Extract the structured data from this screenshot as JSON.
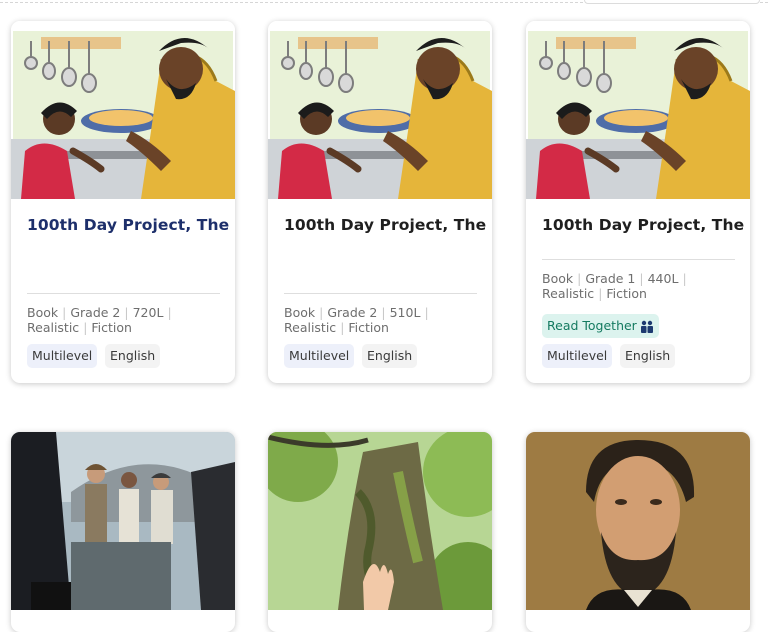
{
  "cards": [
    {
      "title": "100th Day Project, The",
      "meta": {
        "type": "Book",
        "grade": "Grade 2",
        "level": "720L",
        "genre": "Realistic",
        "category": "Fiction"
      },
      "tags": [
        "Multilevel",
        "English"
      ]
    },
    {
      "title": "100th Day Project, The",
      "meta": {
        "type": "Book",
        "grade": "Grade 2",
        "level": "510L",
        "genre": "Realistic",
        "category": "Fiction"
      },
      "tags": [
        "Multilevel",
        "English"
      ]
    },
    {
      "title": "100th Day Project, The",
      "meta": {
        "type": "Book",
        "grade": "Grade 1",
        "level": "440L",
        "genre": "Realistic",
        "category": "Fiction"
      },
      "badge": {
        "label": "Read Together",
        "icon": "read-together-icon"
      },
      "tags": [
        "Multilevel",
        "English"
      ]
    }
  ],
  "colors": {
    "title_link": "#1d2f6b",
    "title": "#1f1f1f",
    "multilevel_bg": "#edf0fa",
    "language_bg": "#f3f3f3",
    "read_together_bg": "#dcf3ee",
    "read_together_text": "#147a60"
  }
}
